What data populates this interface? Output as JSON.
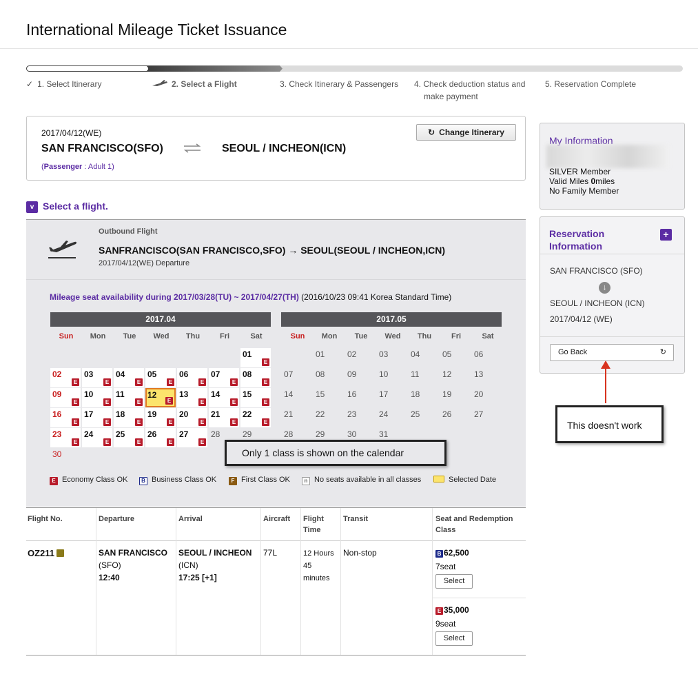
{
  "page_title": "International Mileage Ticket Issuance",
  "steps": [
    {
      "label": "1. Select Itinerary",
      "state": "done",
      "icon": "check-icon"
    },
    {
      "label": "2. Select a Flight",
      "state": "current",
      "icon": "plane-icon"
    },
    {
      "label": "3. Check Itinerary & Passengers",
      "state": "todo"
    },
    {
      "label": "4. Check deduction status and make payment",
      "state": "todo"
    },
    {
      "label": "5. Reservation Complete",
      "state": "todo"
    }
  ],
  "itinerary": {
    "date": "2017/04/12(WE)",
    "from": "SAN FRANCISCO(SFO)",
    "to": "SEOUL / INCHEON(ICN)",
    "passenger_label": "Passenger",
    "passenger_value": ": Adult 1)",
    "passenger_open": "(",
    "change_button": "Change Itinerary",
    "swap_icon": "swap-arrows-icon"
  },
  "select_flight": {
    "badge": "v",
    "title": "Select a flight."
  },
  "outbound": {
    "label": "Outbound Flight",
    "route": "SANFRANCISCO(SAN FRANCISCO,SFO) → SEOUL(SEOUL / INCHEON,ICN)",
    "departure": "2017/04/12(WE) Departure"
  },
  "availability": {
    "prefix": "Mileage seat availability during 2017/03/28(TU) ~ 2017/04/27(TH)",
    "suffix": " (2016/10/23 09:41 Korea Standard Time)"
  },
  "calendars": [
    {
      "title": "2017.04",
      "weekdays": [
        "Sun",
        "Mon",
        "Tue",
        "Wed",
        "Thu",
        "Fri",
        "Sat"
      ],
      "available_days": [
        "01",
        "02",
        "03",
        "04",
        "05",
        "06",
        "07",
        "08",
        "09",
        "10",
        "11",
        "12",
        "13",
        "14",
        "15",
        "16",
        "17",
        "18",
        "19",
        "20",
        "21",
        "22",
        "23",
        "24",
        "25",
        "26",
        "27"
      ],
      "other_days": [
        "28",
        "29",
        "30"
      ],
      "selected": "12"
    },
    {
      "title": "2017.05",
      "weekdays": [
        "Sun",
        "Mon",
        "Tue",
        "Wed",
        "Thu",
        "Fri",
        "Sat"
      ],
      "days": [
        "01",
        "02",
        "03",
        "04",
        "05",
        "06",
        "07",
        "08",
        "09",
        "10",
        "11",
        "12",
        "13",
        "14",
        "15",
        "16",
        "17",
        "18",
        "19",
        "20",
        "21",
        "22",
        "23",
        "24",
        "25",
        "26",
        "27",
        "28",
        "29",
        "30",
        "31"
      ]
    }
  ],
  "class_badge": "E",
  "legend": [
    {
      "badge": "E",
      "label": "Economy Class OK",
      "color": "#b81c2b"
    },
    {
      "badge": "B",
      "label": "Business Class OK",
      "color": "#1c2a8a"
    },
    {
      "badge": "F",
      "label": "First Class OK",
      "color": "#8a5a12"
    },
    {
      "badge": "n",
      "label": "No seats available in all classes",
      "color": "#888888"
    },
    {
      "badge": "",
      "label": "Selected Date",
      "color": "#fce46c"
    }
  ],
  "annotation_calendar": "Only 1 class is shown on the calendar",
  "annotation_goback": "This doesn't work",
  "table": {
    "headers": [
      "Flight No.",
      "Departure",
      "Arrival",
      "Aircraft",
      "Flight Time",
      "Transit",
      "Seat and Redemption Class"
    ],
    "row": {
      "flight_no": "OZ211",
      "dep_city": "SAN FRANCISCO",
      "dep_code": "(SFO)",
      "dep_time": "12:40",
      "arr_city": "SEOUL / INCHEON",
      "arr_code": "(ICN)",
      "arr_time": "17:25 [+1]",
      "aircraft": "77L",
      "flight_time": "12 Hours 45 minutes",
      "transit": "Non-stop",
      "options": [
        {
          "badge": "B",
          "miles": "62,500",
          "seats": "7seat",
          "button": "Select",
          "color": "#1c2a8a"
        },
        {
          "badge": "E",
          "miles": "35,000",
          "seats": "9seat",
          "button": "Select",
          "color": "#b81c2b"
        }
      ]
    }
  },
  "my_info": {
    "title": "My Information",
    "tier": "SILVER Member",
    "miles_prefix": "Valid Miles ",
    "miles_value": "0",
    "miles_suffix": "miles",
    "family": "No Family Member"
  },
  "reservation": {
    "title": "Reservation Information",
    "from": "SAN FRANCISCO (SFO)",
    "to": "SEOUL / INCHEON (ICN)",
    "date": "2017/04/12 (WE)",
    "go_back": "Go Back"
  },
  "colors": {
    "purple": "#5b2ca3",
    "red": "#c81f1f",
    "header_gray": "#555559",
    "panel_gray": "#e8e8eb"
  }
}
